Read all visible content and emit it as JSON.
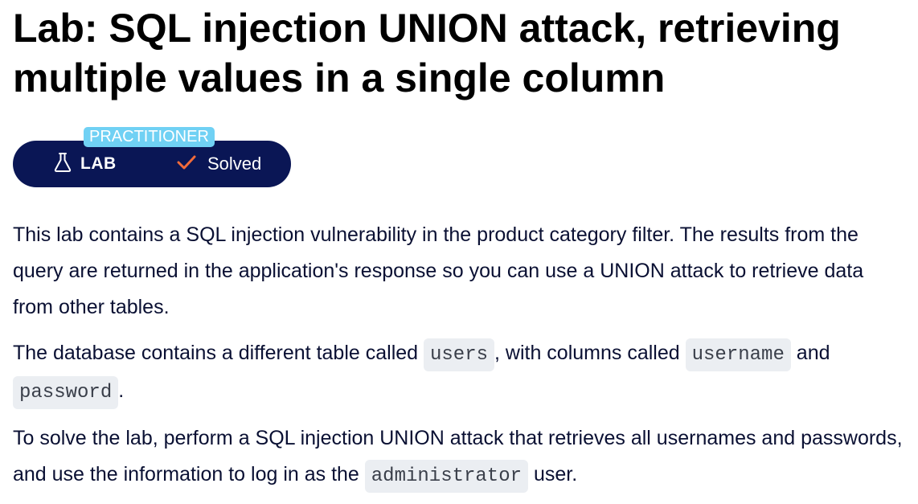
{
  "title": "Lab: SQL injection UNION attack, retrieving multiple values in a single column",
  "badge": {
    "level": "PRACTITIONER",
    "type_label": "LAB",
    "status_label": "Solved",
    "icons": {
      "type": "flask-icon",
      "status": "check-icon"
    },
    "colors": {
      "pill_bg": "#0a1655",
      "level_bg": "#70d1f4",
      "check": "#f26b3a"
    }
  },
  "description": {
    "p1": "This lab contains a SQL injection vulnerability in the product category filter. The results from the query are returned in the application's response so you can use a UNION attack to retrieve data from other tables.",
    "p2": {
      "t1": "The database contains a different table called ",
      "c1": "users",
      "t2": ", with columns called ",
      "c2": "username",
      "t3": " and ",
      "c3": "password",
      "t4": "."
    },
    "p3": {
      "t1": "To solve the lab, perform a SQL injection UNION attack that retrieves all usernames and passwords, and use the information to log in as the ",
      "c1": "administrator",
      "t2": " user."
    }
  }
}
